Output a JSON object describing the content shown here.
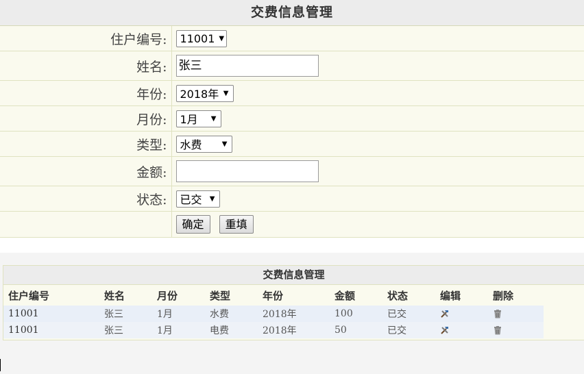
{
  "form": {
    "title": "交费信息管理",
    "fields": {
      "resident_no": {
        "label": "住户编号:",
        "value": "11001"
      },
      "name": {
        "label": "姓名:",
        "value": "张三"
      },
      "year": {
        "label": "年份:",
        "value": "2018年"
      },
      "month": {
        "label": "月份:",
        "value": "1月"
      },
      "type": {
        "label": "类型:",
        "value": "水费"
      },
      "amount": {
        "label": "金额:",
        "value": ""
      },
      "status": {
        "label": "状态:",
        "value": "已交"
      }
    },
    "buttons": {
      "confirm": "确定",
      "reset": "重填"
    }
  },
  "list": {
    "title": "交费信息管理",
    "columns": [
      "住户编号",
      "姓名",
      "月份",
      "类型",
      "年份",
      "金额",
      "状态",
      "编辑",
      "删除"
    ],
    "rows": [
      {
        "resident_no": "11001",
        "name": "张三",
        "month": "1月",
        "type": "水费",
        "year": "2018年",
        "amount": "100",
        "status": "已交"
      },
      {
        "resident_no": "11001",
        "name": "张三",
        "month": "1月",
        "type": "电费",
        "year": "2018年",
        "amount": "50",
        "status": "已交"
      }
    ],
    "icons": {
      "edit": "edit-tools-icon",
      "delete": "trash-icon"
    }
  }
}
